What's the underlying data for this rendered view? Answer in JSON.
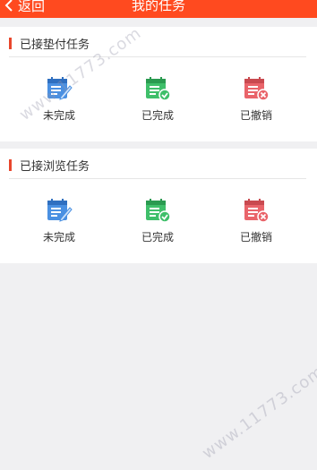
{
  "header": {
    "back_label": "返回",
    "title": "我的任务"
  },
  "sections": [
    {
      "title": "已接垫付任务",
      "items": [
        {
          "label": "未完成",
          "icon": "calendar-edit-icon",
          "color": "#4a90e2"
        },
        {
          "label": "已完成",
          "icon": "calendar-check-icon",
          "color": "#3fbf6a"
        },
        {
          "label": "已撤销",
          "icon": "calendar-cancel-icon",
          "color": "#e9646a"
        }
      ]
    },
    {
      "title": "已接浏览任务",
      "items": [
        {
          "label": "未完成",
          "icon": "calendar-edit-icon",
          "color": "#4a90e2"
        },
        {
          "label": "已完成",
          "icon": "calendar-check-icon",
          "color": "#3fbf6a"
        },
        {
          "label": "已撤销",
          "icon": "calendar-cancel-icon",
          "color": "#e9646a"
        }
      ]
    }
  ],
  "watermark": "www.11773.com",
  "colors": {
    "header": "#ff4a1f",
    "accent_bar": "#e8462c"
  }
}
